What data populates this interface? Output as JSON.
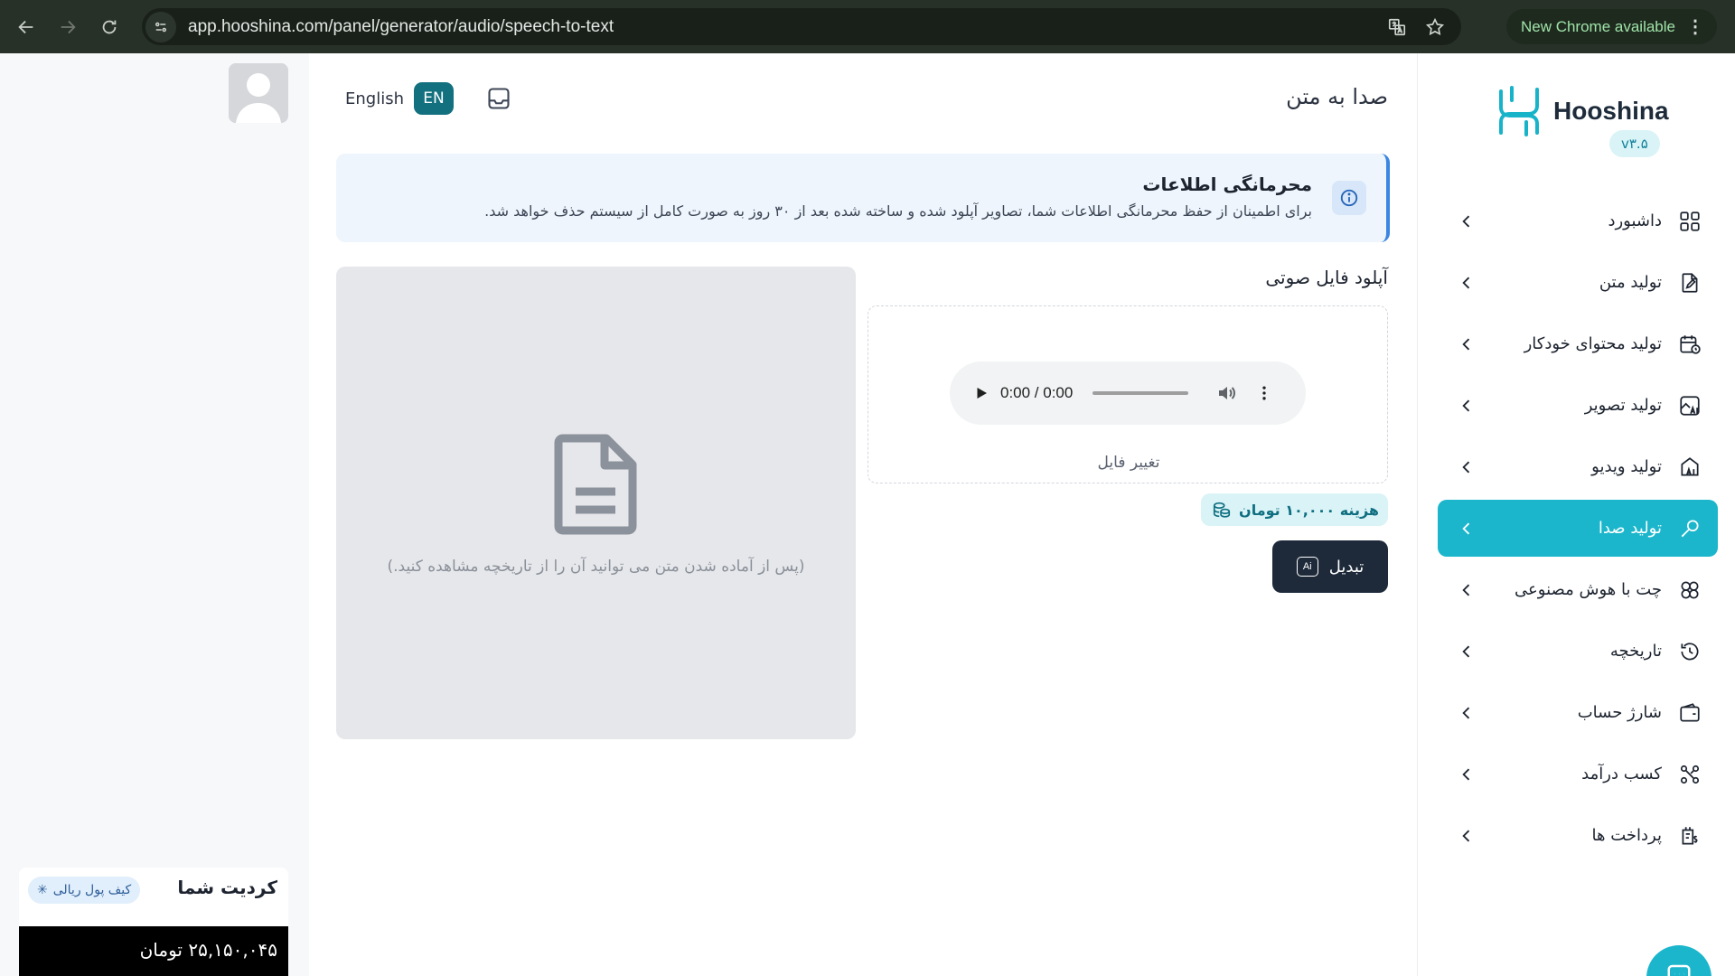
{
  "browser": {
    "url": "app.hooshina.com/panel/generator/audio/speech-to-text",
    "update_label": "New Chrome available"
  },
  "brand": {
    "name": "Hooshina",
    "version": "v۳.۵",
    "accent": "#1bb6cc"
  },
  "sidebar": {
    "items": [
      {
        "label": "داشبورد",
        "icon": "dashboard-grid-icon",
        "active": false
      },
      {
        "label": "تولید متن",
        "icon": "document-edit-icon",
        "active": false
      },
      {
        "label": "تولید محتوای خودکار",
        "icon": "calendar-clock-icon",
        "active": false
      },
      {
        "label": "تولید تصویر",
        "icon": "ai-image-icon",
        "active": false
      },
      {
        "label": "تولید ویدیو",
        "icon": "ai-video-icon",
        "active": false
      },
      {
        "label": "تولید صدا",
        "icon": "microphone-icon",
        "active": true
      },
      {
        "label": "چت با هوش مصنوعی",
        "icon": "ai-chat-icon",
        "active": false
      },
      {
        "label": "تاریخچه",
        "icon": "history-icon",
        "active": false
      },
      {
        "label": "شارژ حساب",
        "icon": "wallet-icon",
        "active": false
      },
      {
        "label": "کسب درآمد",
        "icon": "network-icon",
        "active": false
      },
      {
        "label": "پرداخت ها",
        "icon": "payments-icon",
        "active": false
      }
    ]
  },
  "header": {
    "page_title": "صدا به متن",
    "lang_label": "English",
    "lang_code": "EN"
  },
  "notice": {
    "title": "محرمانگی اطلاعات",
    "text": "برای اطمینان از حفظ محرمانگی اطلاعات شما، تصاویر آپلود شده و ساخته شده بعد از ۳۰ روز به صورت کامل از سیستم حذف خواهد شد."
  },
  "upload": {
    "title": "آپلود فایل صوتی",
    "player_time": "0:00 / 0:00",
    "change_file": "تغییر فایل",
    "cost": "هزینه ۱۰,۰۰۰ تومان",
    "convert": "تبدیل",
    "ai_badge": "Ai"
  },
  "result": {
    "hint": "(پس از آماده شدن متن می توانید آن را از تاریخچه مشاهده کنید.)"
  },
  "credit": {
    "title": "کردیت شما",
    "wallet_label": "کیف پول ریالی",
    "balance": "۲۵,۱۵۰,۰۴۵ تومان"
  }
}
